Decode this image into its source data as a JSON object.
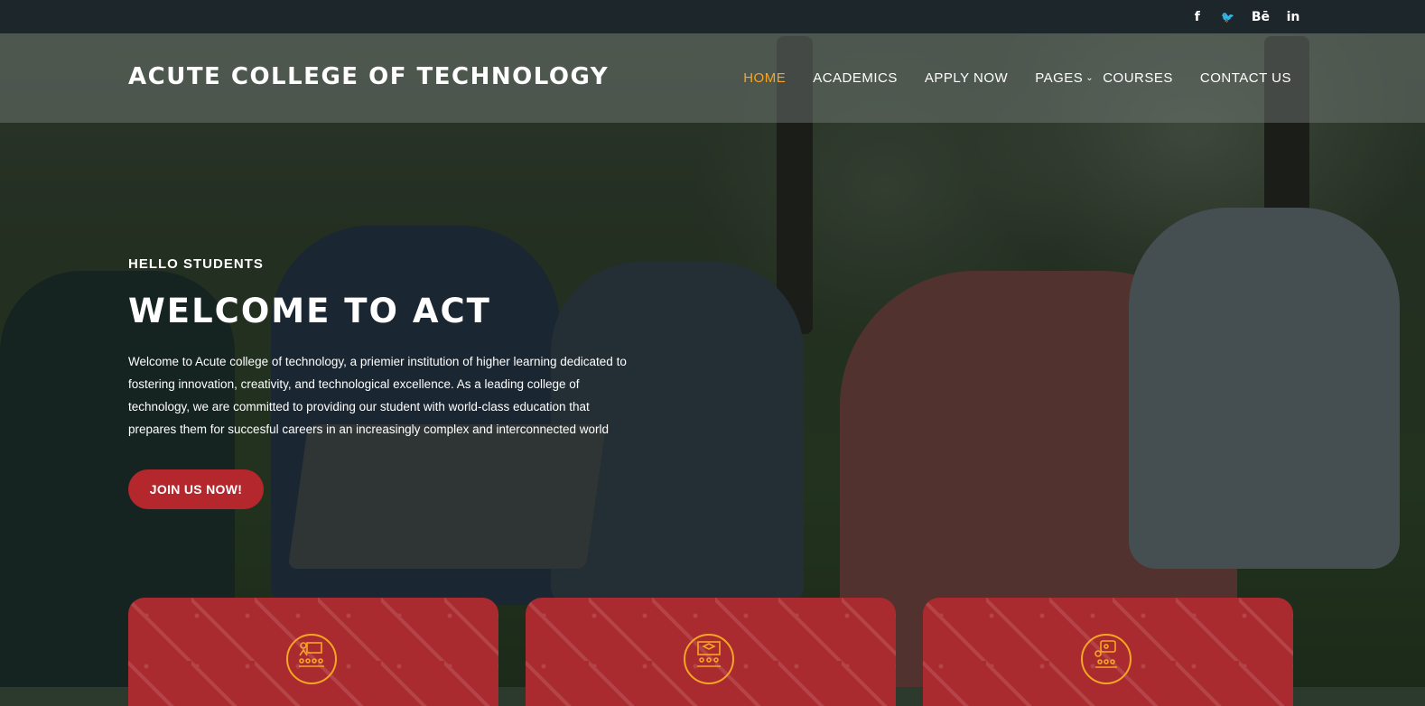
{
  "social": [
    {
      "name": "facebook-icon",
      "glyph": "f"
    },
    {
      "name": "twitter-icon",
      "glyph": "🐦"
    },
    {
      "name": "behance-icon",
      "glyph": "Bē"
    },
    {
      "name": "linkedin-icon",
      "glyph": "in"
    }
  ],
  "header": {
    "brand": "ACUTE COLLEGE OF TECHNOLOGY",
    "nav": [
      {
        "label": "HOME",
        "active": true
      },
      {
        "label": "ACADEMICS"
      },
      {
        "label": "APPLY NOW"
      },
      {
        "label": "PAGES",
        "has_dropdown": true
      },
      {
        "label": "COURSES"
      },
      {
        "label": "CONTACT US"
      }
    ]
  },
  "hero": {
    "kicker": "HELLO STUDENTS",
    "title": "WELCOME TO ACT",
    "description": "Welcome to Acute college of technology, a priemier institution of higher learning dedicated to fostering innovation, creativity, and technological excellence. As a leading college of technology, we are committed to providing our student with world-class education that prepares them for succesful careers in an increasingly complex and interconnected world",
    "cta_label": "JOIN US NOW!"
  },
  "cards": [
    {
      "icon": "presentation-icon"
    },
    {
      "icon": "lecture-icon"
    },
    {
      "icon": "group-discussion-icon"
    }
  ],
  "colors": {
    "accent": "#f5a623",
    "primary": "#b3272d",
    "topbar": "#1d272b"
  }
}
